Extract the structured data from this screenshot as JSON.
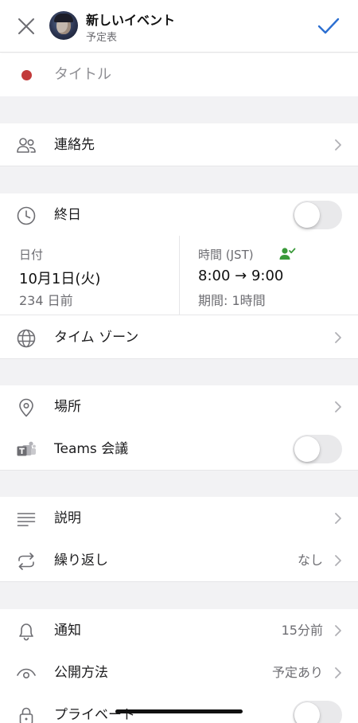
{
  "header": {
    "close_icon": "close-icon",
    "title": "新しいイベント",
    "subtitle": "予定表",
    "confirm_icon": "checkmark-icon",
    "accent_color": "#2c6fd1"
  },
  "title_field": {
    "placeholder": "タイトル",
    "color_dot": "#c23a3a"
  },
  "contacts": {
    "label": "連絡先",
    "icon": "people-icon"
  },
  "all_day": {
    "label": "終日",
    "icon": "clock-icon",
    "on": false
  },
  "date": {
    "label": "日付",
    "value": "10月1日(火)",
    "relative": "234 日前"
  },
  "time": {
    "label": "時間 (JST)",
    "value": "8:00 → 9:00",
    "duration": "期間: 1時間",
    "availability_color": "#3a9a3a"
  },
  "timezone": {
    "label": "タイム ゾーン",
    "icon": "globe-icon"
  },
  "location": {
    "label": "場所",
    "icon": "location-pin-icon"
  },
  "teams": {
    "label": "Teams 会議",
    "icon": "teams-icon",
    "on": false
  },
  "description": {
    "label": "説明",
    "icon": "text-lines-icon"
  },
  "repeat": {
    "label": "繰り返し",
    "value": "なし",
    "icon": "repeat-icon"
  },
  "notification": {
    "label": "通知",
    "value": "15分前",
    "icon": "bell-icon"
  },
  "visibility": {
    "label": "公開方法",
    "value": "予定あり",
    "icon": "eye-icon"
  },
  "private": {
    "label": "プライベート",
    "icon": "lock-icon",
    "on": false
  }
}
